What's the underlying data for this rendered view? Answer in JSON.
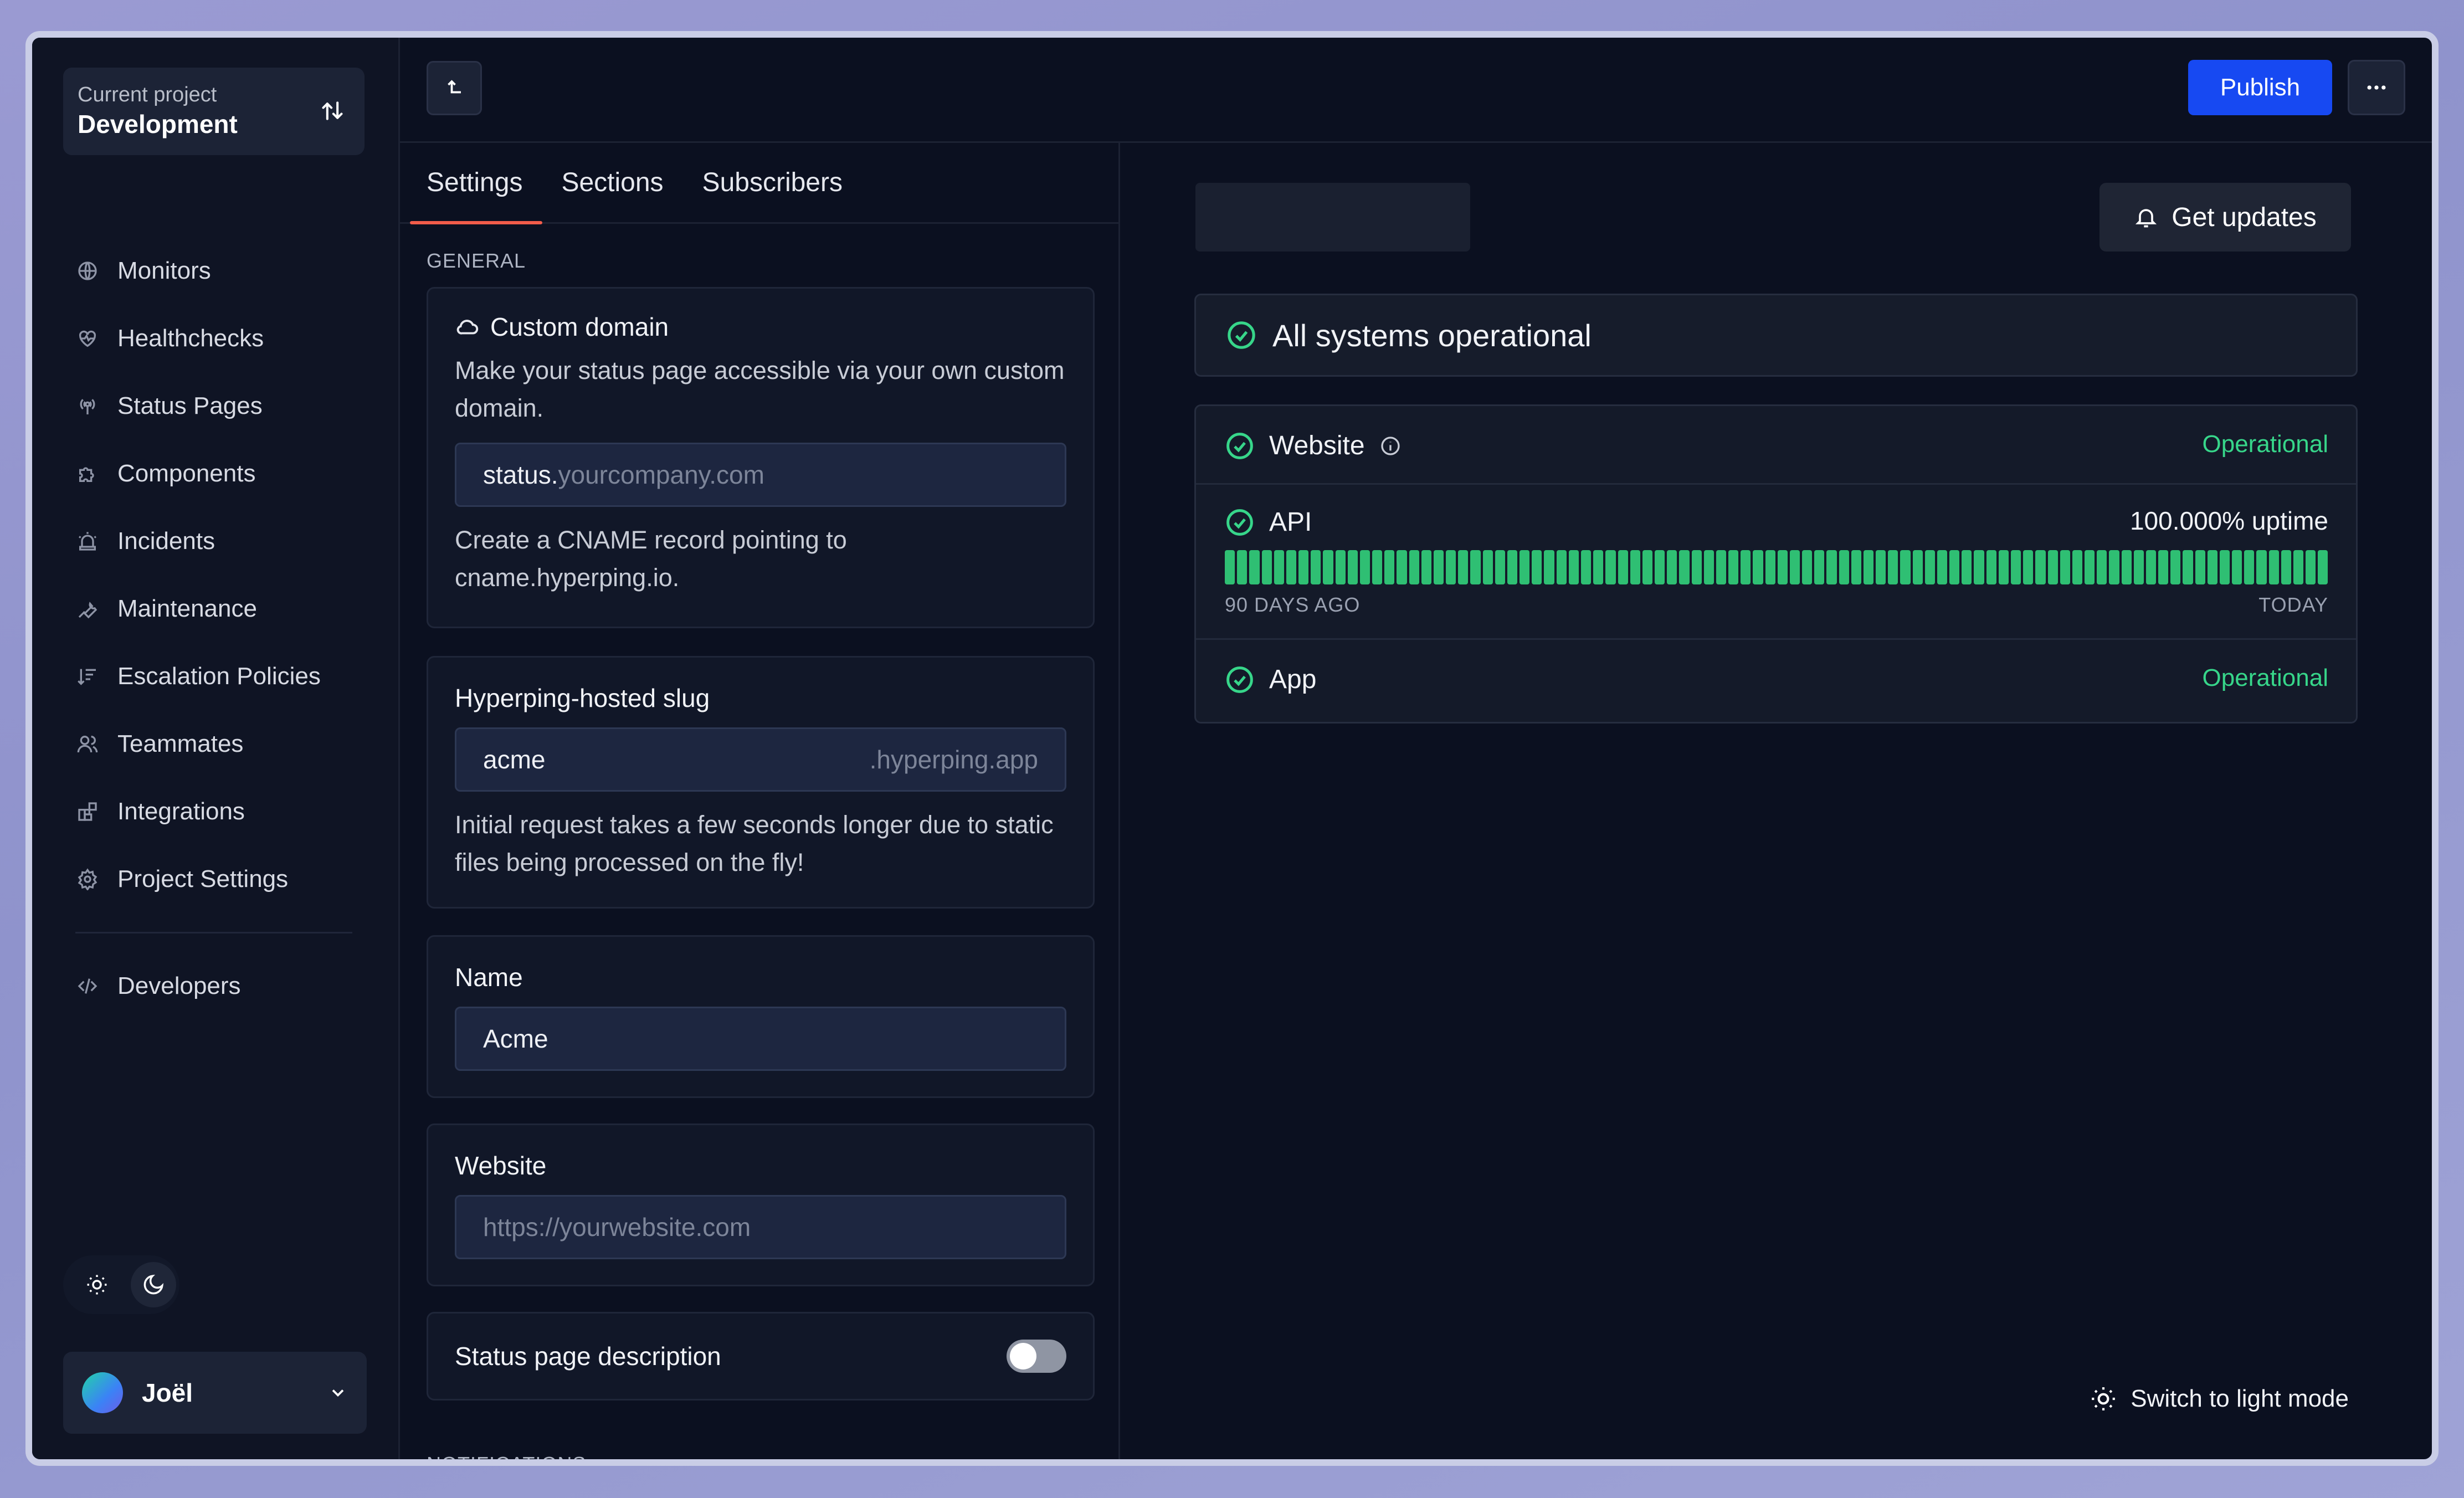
{
  "sidebar": {
    "project_label": "Current project",
    "project_name": "Development",
    "items": [
      {
        "label": "Monitors",
        "icon": "monitor-globe-icon"
      },
      {
        "label": "Healthchecks",
        "icon": "heart-pulse-icon"
      },
      {
        "label": "Status Pages",
        "icon": "broadcast-icon"
      },
      {
        "label": "Components",
        "icon": "puzzle-icon"
      },
      {
        "label": "Incidents",
        "icon": "siren-icon"
      },
      {
        "label": "Maintenance",
        "icon": "wrench-icon"
      },
      {
        "label": "Escalation Policies",
        "icon": "escalation-icon"
      },
      {
        "label": "Teammates",
        "icon": "users-icon"
      },
      {
        "label": "Integrations",
        "icon": "blocks-icon"
      },
      {
        "label": "Project Settings",
        "icon": "gear-icon"
      }
    ],
    "developers": {
      "label": "Developers",
      "icon": "code-icon"
    },
    "user_name": "Joël"
  },
  "toolbar": {
    "publish_label": "Publish"
  },
  "settings": {
    "tabs": [
      "Settings",
      "Sections",
      "Subscribers"
    ],
    "general_label": "GENERAL",
    "custom_domain": {
      "title": "Custom domain",
      "description": "Make your status page accessible via your own custom domain.",
      "prefix": "status.",
      "placeholder": "yourcompany.com",
      "hint": "Create a CNAME record pointing to cname.hyperping.io."
    },
    "slug": {
      "title": "Hyperping-hosted slug",
      "value": "acme",
      "suffix": ".hyperping.app",
      "hint": "Initial request takes a few seconds longer due to static files being processed on the fly!"
    },
    "name": {
      "title": "Name",
      "value": "Acme"
    },
    "website": {
      "title": "Website",
      "placeholder": "https://yourwebsite.com"
    },
    "description_toggle": {
      "label": "Status page description",
      "enabled": false
    },
    "notifications_label": "NOTIFICATIONS"
  },
  "preview": {
    "get_updates_label": "Get updates",
    "banner": "All systems operational",
    "components": [
      {
        "name": "Website",
        "status": "Operational"
      },
      {
        "name": "API",
        "uptime": "100.000% uptime",
        "range_start": "90 DAYS AGO",
        "range_end": "TODAY"
      },
      {
        "name": "App",
        "status": "Operational"
      }
    ],
    "switch_mode_label": "Switch to light mode"
  },
  "colors": {
    "accent": "#1749f2",
    "operational": "#37d68a",
    "uptime_bar": "#2fbf73",
    "active_tab": "#f25c4a"
  }
}
